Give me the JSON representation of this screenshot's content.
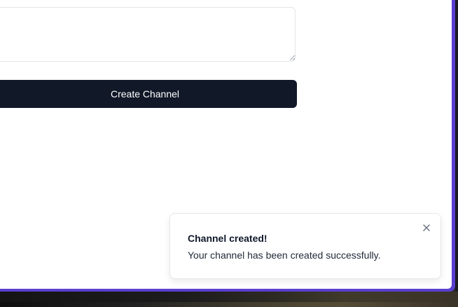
{
  "form": {
    "description_value": "",
    "create_button_label": "Create Channel"
  },
  "toast": {
    "title": "Channel created!",
    "description": "Your channel has been created successfully.",
    "close_icon": "close-icon"
  },
  "colors": {
    "button_bg": "#111827",
    "window_border": "#5b3fd0",
    "toast_border": "#e5e7eb"
  }
}
